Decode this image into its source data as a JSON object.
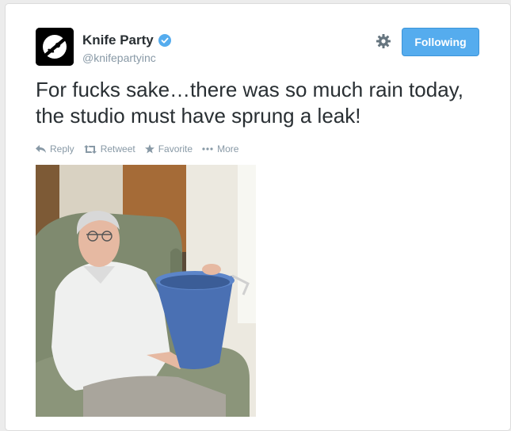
{
  "user": {
    "name": "Knife Party",
    "handle": "@knifepartyinc",
    "verified": true,
    "avatar_icon": "knife-party-logo"
  },
  "header": {
    "follow_label": "Following",
    "settings_icon": "gear-icon"
  },
  "tweet": {
    "text": "For fucks sake…there was so much rain today, the studio must have sprung a leak!"
  },
  "actions": {
    "reply": "Reply",
    "retweet": "Retweet",
    "favorite": "Favorite",
    "more": "More"
  },
  "colors": {
    "accent": "#55acee",
    "text": "#292f33",
    "muted": "#8899a6"
  }
}
